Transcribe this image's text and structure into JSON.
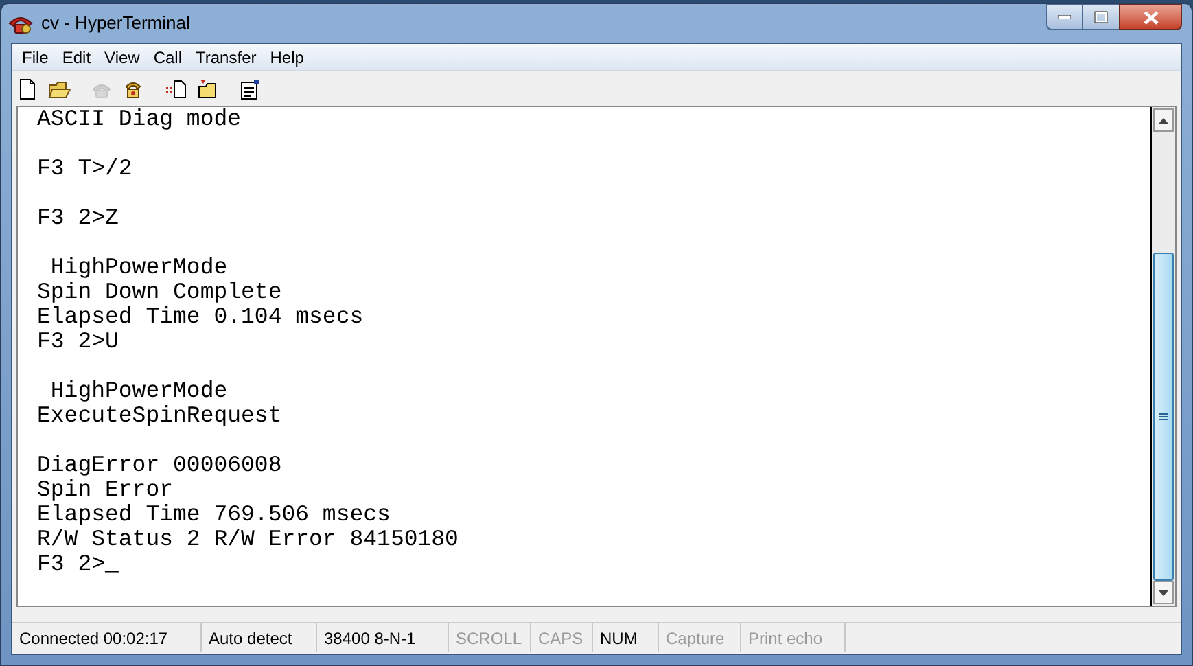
{
  "window": {
    "title": "cv - HyperTerminal"
  },
  "menu": [
    "File",
    "Edit",
    "View",
    "Call",
    "Transfer",
    "Help"
  ],
  "toolbar": [
    {
      "kind": "new",
      "disabled": false
    },
    {
      "kind": "open",
      "disabled": false
    },
    {
      "kind": "disconnect",
      "disabled": true
    },
    {
      "kind": "dial",
      "disabled": false
    },
    {
      "kind": "send",
      "disabled": false
    },
    {
      "kind": "receive",
      "disabled": false
    },
    {
      "kind": "properties",
      "disabled": false
    }
  ],
  "terminal": {
    "blocks": [
      [
        "ASCII Diag mode"
      ],
      [
        "F3 T>/2"
      ],
      [
        "F3 2>Z"
      ],
      [
        " HighPowerMode",
        "Spin Down Complete",
        "Elapsed Time 0.104 msecs",
        "F3 2>U"
      ],
      [
        " HighPowerMode",
        "ExecuteSpinRequest"
      ],
      [
        "DiagError 00006008",
        "Spin Error",
        "Elapsed Time 769.506 msecs",
        "R/W Status 2 R/W Error 84150180",
        "F3 2>_"
      ]
    ]
  },
  "status_bar": [
    {
      "text": "Connected 00:02:17",
      "disabled": false
    },
    {
      "text": "Auto detect",
      "disabled": false
    },
    {
      "text": "38400 8-N-1",
      "disabled": false
    },
    {
      "text": "SCROLL",
      "disabled": true
    },
    {
      "text": "CAPS",
      "disabled": true
    },
    {
      "text": "NUM",
      "disabled": false
    },
    {
      "text": "Capture",
      "disabled": true
    },
    {
      "text": "Print echo",
      "disabled": true
    }
  ]
}
